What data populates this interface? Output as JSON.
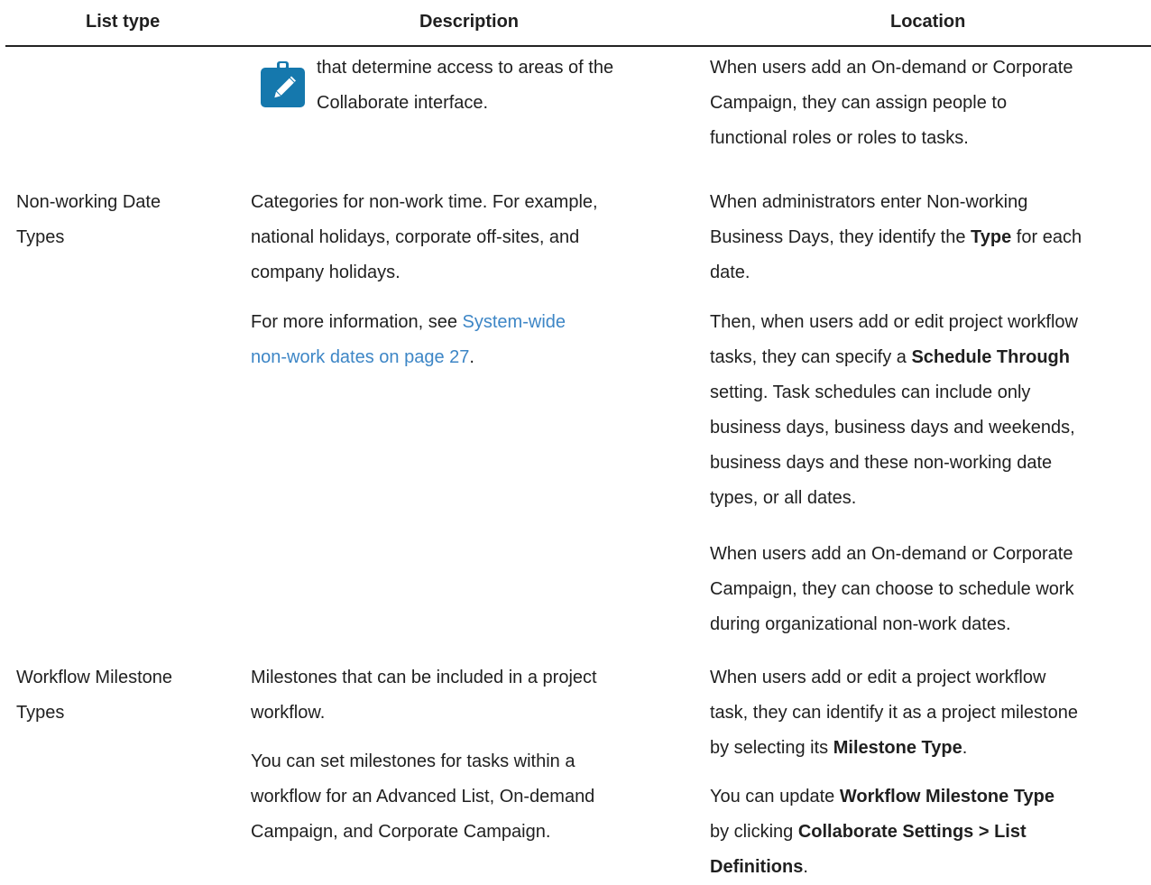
{
  "table": {
    "headers": {
      "list_type": "List type",
      "description": "Description",
      "location": "Location"
    },
    "continued_row": {
      "description_note": [
        "that determine access to areas of the",
        "Collaborate interface."
      ],
      "location": [
        "When users add an On-demand or Corporate",
        "Campaign, they can assign people to",
        "functional roles or roles to tasks."
      ]
    },
    "row_non_working": {
      "list_type": [
        "Non-working Date",
        "Types"
      ],
      "description": [
        "Categories for non-work time. For example,",
        "national holidays, corporate off-sites, and",
        "company holidays."
      ],
      "description_more_prefix": "For more information, see ",
      "description_link": [
        "System-wide",
        "non-work dates on page 27"
      ],
      "description_more_suffix": ".",
      "location_p1_line1": "When administrators enter Non-working",
      "location_p1_line2_prefix": "Business Days, they identify the ",
      "location_p1_line2_bold": "Type",
      "location_p1_line2_suffix": " for each",
      "location_p1_line3": "date.",
      "location_p2_line1": "Then, when users add or edit project workflow",
      "location_p2_line2_prefix": "tasks, they can specify a ",
      "location_p2_line2_bold": "Schedule Through",
      "location_p2_rest": [
        "setting. Task schedules can include only",
        "business days, business days and weekends,",
        "business days and these non-working date",
        "types, or all dates."
      ],
      "location_p3": [
        "When users add an On-demand or Corporate",
        "Campaign, they can choose to schedule work",
        "during organizational non-work dates."
      ]
    },
    "row_milestone": {
      "list_type": [
        "Workflow Milestone",
        "Types"
      ],
      "description_p1": [
        "Milestones that can be included in a project",
        "workflow."
      ],
      "description_p2": [
        "You can set milestones for tasks within a",
        "workflow for an Advanced List, On-demand",
        "Campaign, and Corporate Campaign."
      ],
      "location_p1_line1": "When users add or edit a project workflow",
      "location_p1_line2": "task, they can identify it as a project milestone",
      "location_p1_line3_prefix": "by selecting its ",
      "location_p1_line3_bold": "Milestone Type",
      "location_p1_line3_suffix": ".",
      "location_p2_line1_prefix": "You can update ",
      "location_p2_line1_bold": "Workflow Milestone Type",
      "location_p2_line2_prefix": "by clicking ",
      "location_p2_line2_bold": "Collaborate Settings > List",
      "location_p2_line3_bold": "Definitions",
      "location_p2_line3_suffix": "."
    }
  },
  "colors": {
    "note_icon": "#1578ad",
    "link": "#3d86c6"
  },
  "icons": {
    "note": "pencil-note-icon"
  }
}
